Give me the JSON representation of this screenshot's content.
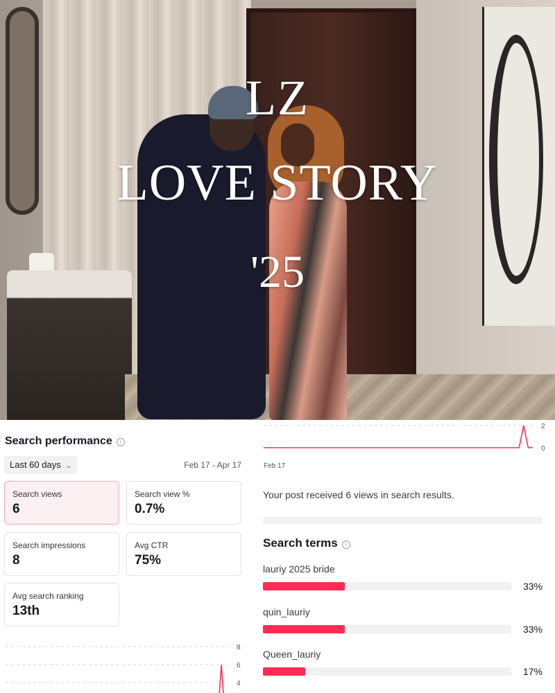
{
  "poster": {
    "title_line1": "LZ",
    "title_line2": "LOVE STORY",
    "title_line3": "'25"
  },
  "search_performance": {
    "title": "Search performance",
    "info_icon": "info-icon",
    "range_label": "Last 60 days",
    "range_icon": "chevron-down-icon",
    "date_range": "Feb 17 - Apr 17",
    "metrics": [
      {
        "label": "Search views",
        "value": "6",
        "selected": true
      },
      {
        "label": "Search view %",
        "value": "0.7%",
        "selected": false
      },
      {
        "label": "Search impressions",
        "value": "8",
        "selected": false
      },
      {
        "label": "Avg CTR",
        "value": "75%",
        "selected": false
      },
      {
        "label": "Avg search ranking",
        "value": "13th",
        "selected": false
      }
    ]
  },
  "chart_data": [
    {
      "type": "line",
      "ylim": [
        0,
        2
      ],
      "y_ticks": [
        "2",
        "0"
      ],
      "x_start_label": "Feb 17",
      "series": [
        {
          "color": "#fe2c55",
          "values": [
            0,
            0,
            0,
            0,
            0,
            0,
            0,
            0,
            0,
            0,
            0,
            0,
            0,
            0,
            0,
            0,
            0,
            0,
            0,
            0,
            0,
            0,
            0,
            0,
            0,
            0,
            0,
            0,
            0,
            0,
            0,
            0,
            0,
            0,
            0,
            0,
            0,
            0,
            0,
            0,
            0,
            0,
            0,
            0,
            0,
            0,
            0,
            0,
            0,
            0,
            0,
            0,
            0,
            0,
            0,
            0,
            0,
            2,
            0,
            0
          ]
        }
      ]
    },
    {
      "type": "line",
      "y_ticks": [
        "8",
        "6",
        "4"
      ],
      "series": [
        {
          "color": "#fe2c55",
          "values": [
            0,
            0,
            0,
            0,
            0,
            0,
            0,
            0,
            0,
            0,
            0,
            0,
            0,
            0,
            0,
            0,
            0,
            0,
            0,
            0,
            0,
            0,
            0,
            0,
            0,
            0,
            0,
            0,
            0,
            0,
            0,
            0,
            0,
            0,
            0,
            0,
            0,
            0,
            0,
            0,
            0,
            0,
            0,
            0,
            0,
            0,
            0,
            0,
            0,
            0,
            0,
            0,
            0,
            0,
            0,
            0,
            0,
            6,
            0,
            0
          ]
        }
      ]
    }
  ],
  "summary_text": "Your post received 6 views in search results.",
  "search_terms": {
    "title": "Search terms",
    "info_icon": "info-icon",
    "items": [
      {
        "term": "lauriy 2025 bride",
        "percent": "33%",
        "fraction": 0.33
      },
      {
        "term": "quin_lauriy",
        "percent": "33%",
        "fraction": 0.33
      },
      {
        "term": "Queen_lauriy",
        "percent": "17%",
        "fraction": 0.17
      }
    ]
  },
  "colors": {
    "accent": "#fe2c55",
    "selected_card_bg": "#fdf0f2",
    "selected_card_border": "#f4a6b4"
  }
}
